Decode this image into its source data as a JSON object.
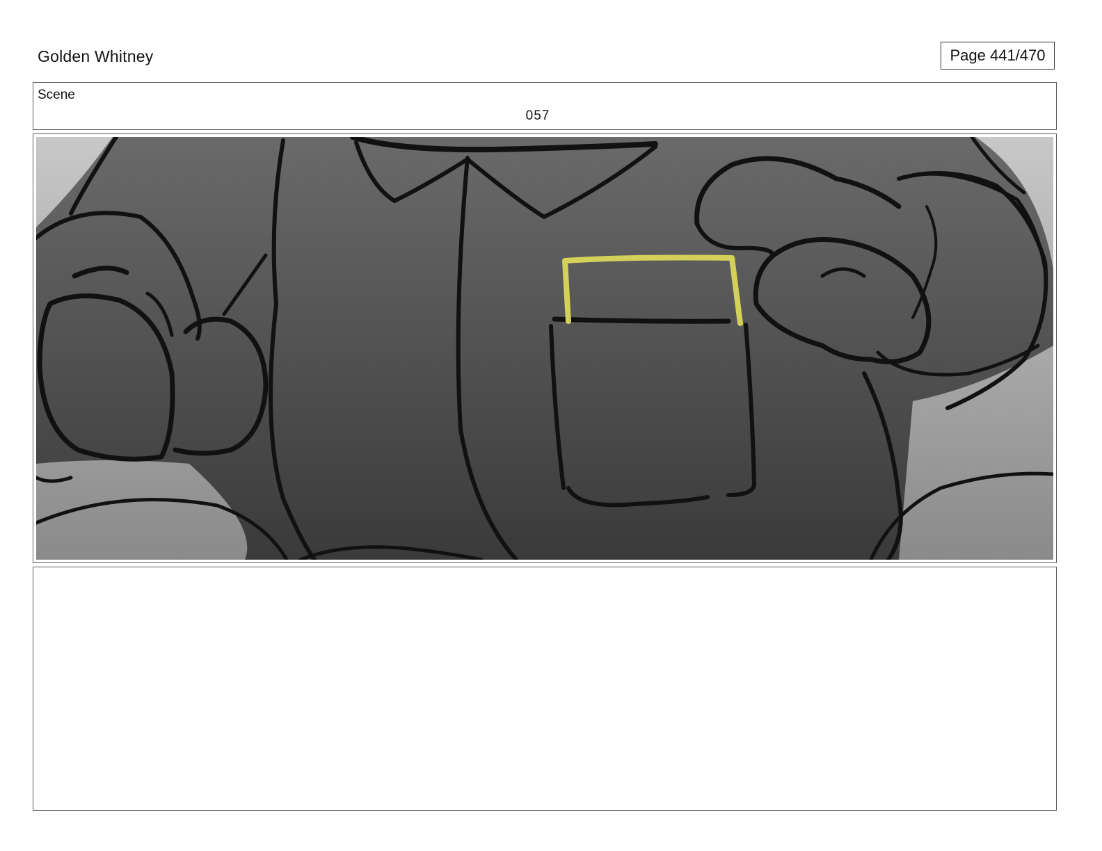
{
  "header": {
    "project_title": "Golden Whitney",
    "page_indicator": "Page 441/470"
  },
  "scene": {
    "label": "Scene",
    "number": "057"
  },
  "panel": {
    "subject": "storyboard-sketch",
    "highlight_color": "#d4d15a",
    "line_color": "#111111"
  },
  "notes": {
    "text": ""
  }
}
